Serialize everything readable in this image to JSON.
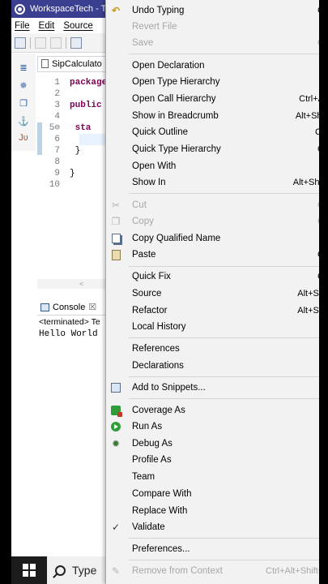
{
  "window": {
    "title": "WorkspaceTech - Te"
  },
  "menubar": [
    "File",
    "Edit",
    "Source"
  ],
  "editor": {
    "tab_label": "SipCalculato",
    "lines": [
      {
        "n": "1",
        "kw": "package",
        "text": ""
      },
      {
        "n": "2",
        "kw": "",
        "text": ""
      },
      {
        "n": "3",
        "kw": "public",
        "text": ""
      },
      {
        "n": "4",
        "kw": "",
        "text": ""
      },
      {
        "n": "5⊖",
        "kw": "   sta",
        "text": ""
      },
      {
        "n": "6",
        "kw": "",
        "text": ""
      },
      {
        "n": "7",
        "kw": "",
        "text": "   }"
      },
      {
        "n": "8",
        "kw": "",
        "text": ""
      },
      {
        "n": "9",
        "kw": "",
        "text": "}"
      },
      {
        "n": "10",
        "kw": "",
        "text": ""
      }
    ],
    "scroll_arrow": "<"
  },
  "console": {
    "tab_label": "Console",
    "close_glyph": "☒",
    "header": "<terminated> Te",
    "output": "Hello World"
  },
  "left_trim_icons": [
    "≣",
    "✵",
    "❐",
    "⚓",
    "Jʋ"
  ],
  "taskbar": {
    "search_text": "Type"
  },
  "context_menu": {
    "items": [
      {
        "id": "undo-typing",
        "label": "Undo Typing",
        "accel": "C",
        "icon": "undo-icon",
        "disabled": false
      },
      {
        "id": "revert-file",
        "label": "Revert File",
        "accel": "",
        "icon": "",
        "disabled": true
      },
      {
        "id": "save",
        "label": "Save",
        "accel": "C",
        "icon": "",
        "disabled": true
      },
      {
        "id": "open-declaration",
        "label": "Open Declaration",
        "accel": "",
        "icon": "",
        "disabled": false
      },
      {
        "id": "open-type-hierarchy",
        "label": "Open Type Hierarchy",
        "accel": "",
        "icon": "",
        "disabled": false
      },
      {
        "id": "open-call-hierarchy",
        "label": "Open Call Hierarchy",
        "accel": "Ctrl+A",
        "icon": "",
        "disabled": false
      },
      {
        "id": "show-in-breadcrumb",
        "label": "Show in Breadcrumb",
        "accel": "Alt+Shi",
        "icon": "",
        "disabled": false
      },
      {
        "id": "quick-outline",
        "label": "Quick Outline",
        "accel": "Ct",
        "icon": "",
        "disabled": false
      },
      {
        "id": "quick-type-hierarchy",
        "label": "Quick Type Hierarchy",
        "accel": "C",
        "icon": "",
        "disabled": false
      },
      {
        "id": "open-with",
        "label": "Open With",
        "accel": "",
        "icon": "",
        "disabled": false
      },
      {
        "id": "show-in",
        "label": "Show In",
        "accel": "Alt+Shif",
        "icon": "",
        "disabled": false
      },
      {
        "id": "cut",
        "label": "Cut",
        "accel": "C",
        "icon": "cut-icon",
        "disabled": true
      },
      {
        "id": "copy",
        "label": "Copy",
        "accel": "C",
        "icon": "copy-icon",
        "disabled": true
      },
      {
        "id": "copy-qualified-name",
        "label": "Copy Qualified Name",
        "accel": "",
        "icon": "copy-qualified-icon",
        "disabled": false
      },
      {
        "id": "paste",
        "label": "Paste",
        "accel": "C",
        "icon": "paste-icon",
        "disabled": false
      },
      {
        "id": "quick-fix",
        "label": "Quick Fix",
        "accel": "C",
        "icon": "",
        "disabled": false
      },
      {
        "id": "source",
        "label": "Source",
        "accel": "Alt+Sh",
        "icon": "",
        "disabled": false
      },
      {
        "id": "refactor",
        "label": "Refactor",
        "accel": "Alt+Sh",
        "icon": "",
        "disabled": false
      },
      {
        "id": "local-history",
        "label": "Local History",
        "accel": "",
        "icon": "",
        "disabled": false
      },
      {
        "id": "references",
        "label": "References",
        "accel": "",
        "icon": "",
        "disabled": false
      },
      {
        "id": "declarations",
        "label": "Declarations",
        "accel": "",
        "icon": "",
        "disabled": false
      },
      {
        "id": "add-to-snippets",
        "label": "Add to Snippets...",
        "accel": "",
        "icon": "snippets-icon",
        "disabled": false
      },
      {
        "id": "coverage-as",
        "label": "Coverage As",
        "accel": "",
        "icon": "coverage-icon",
        "disabled": false
      },
      {
        "id": "run-as",
        "label": "Run As",
        "accel": "",
        "icon": "run-icon",
        "disabled": false
      },
      {
        "id": "debug-as",
        "label": "Debug As",
        "accel": "",
        "icon": "debug-icon",
        "disabled": false
      },
      {
        "id": "profile-as",
        "label": "Profile As",
        "accel": "",
        "icon": "",
        "disabled": false
      },
      {
        "id": "team",
        "label": "Team",
        "accel": "",
        "icon": "",
        "disabled": false
      },
      {
        "id": "compare-with",
        "label": "Compare With",
        "accel": "",
        "icon": "",
        "disabled": false
      },
      {
        "id": "replace-with",
        "label": "Replace With",
        "accel": "",
        "icon": "",
        "disabled": false
      },
      {
        "id": "validate",
        "label": "Validate",
        "accel": "",
        "icon": "check-icon",
        "disabled": false
      },
      {
        "id": "preferences",
        "label": "Preferences...",
        "accel": "",
        "icon": "",
        "disabled": false
      },
      {
        "id": "remove-from-context",
        "label": "Remove from Context",
        "accel": "Ctrl+Alt+Shift+D",
        "icon": "remove-context-icon",
        "disabled": true
      }
    ]
  },
  "colors": {
    "titlebar": "#3b3f8f",
    "keyword": "#7f0055",
    "menu_bg": "#f2f2f2",
    "disabled_text": "#a6a6a6"
  }
}
